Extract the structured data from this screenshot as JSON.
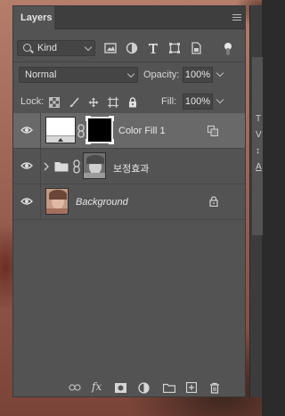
{
  "panel": {
    "tab_label": "Layers",
    "menu_icon": "panel-menu-icon"
  },
  "filter": {
    "kind_label": "Kind",
    "icons": [
      "image-filter-icon",
      "adjustment-filter-icon",
      "type-filter-icon",
      "shape-filter-icon",
      "smart-object-filter-icon"
    ],
    "toggle_icon": "filter-toggle-icon"
  },
  "blend": {
    "mode": "Normal",
    "opacity_label": "Opacity:",
    "opacity_value": "100%"
  },
  "lock": {
    "label": "Lock:",
    "icons": [
      "lock-transparent-pixels-icon",
      "lock-image-pixels-icon",
      "lock-position-icon",
      "lock-artboard-icon",
      "lock-all-icon"
    ],
    "fill_label": "Fill:",
    "fill_value": "100%"
  },
  "layers": [
    {
      "name": "Color Fill 1",
      "selected": true,
      "type": "fill-layer",
      "visible": true
    },
    {
      "name": "보정효과",
      "selected": false,
      "type": "group",
      "visible": true,
      "collapsed": true
    },
    {
      "name": "Background",
      "selected": false,
      "type": "background",
      "visible": true,
      "locked": true
    }
  ],
  "bottom_toolbar": {
    "icons": [
      "link-layers-icon",
      "fx-icon",
      "add-mask-icon",
      "new-adjustment-icon",
      "new-group-icon",
      "new-layer-icon",
      "delete-layer-icon"
    ]
  },
  "side_panel": {
    "glyphs": [
      "T",
      "V",
      "↕",
      "A"
    ]
  },
  "colors": {
    "panel_bg": "#535353",
    "selected_row": "#696969",
    "tab_bar": "#3e3e3e"
  }
}
